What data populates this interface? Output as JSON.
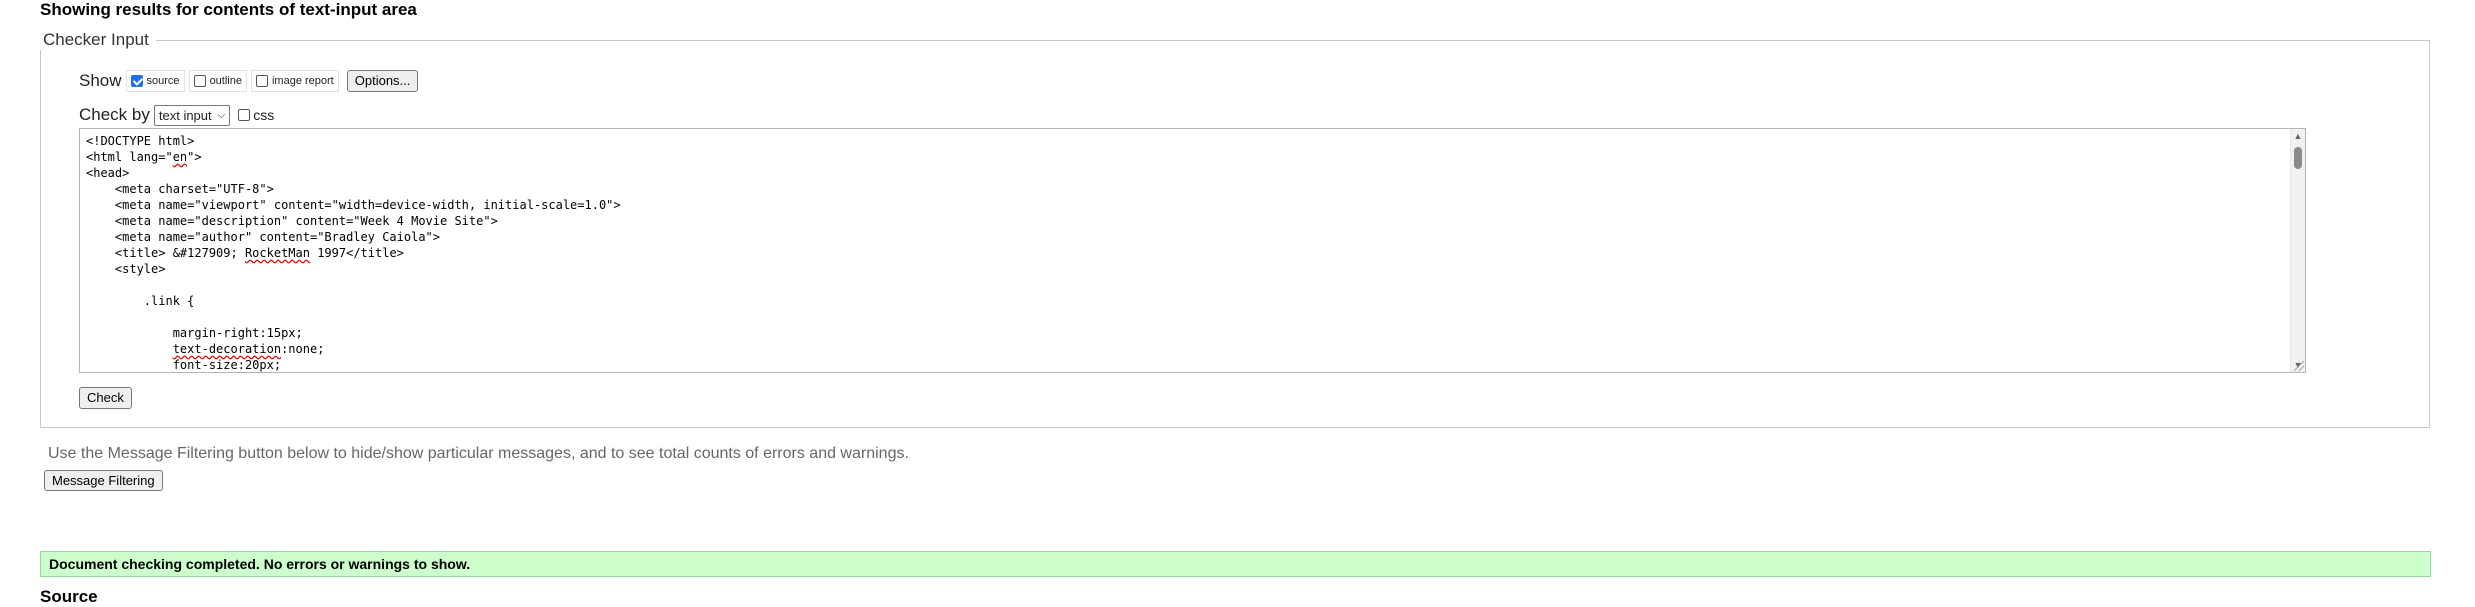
{
  "page": {
    "heading": "Showing results for contents of text-input area"
  },
  "checker": {
    "legend": "Checker Input",
    "show_label": "Show",
    "show_options": [
      {
        "label": "source",
        "checked": true
      },
      {
        "label": "outline",
        "checked": false
      },
      {
        "label": "image report",
        "checked": false
      }
    ],
    "options_button": "Options...",
    "check_by_label": "Check by",
    "check_by_select": "text input",
    "css_label": "css",
    "css_checked": false,
    "check_button": "Check"
  },
  "source_lines": [
    "<!DOCTYPE html>",
    "<html lang=\"en\">",
    "<head>",
    "    <meta charset=\"UTF-8\">",
    "    <meta name=\"viewport\" content=\"width=device-width, initial-scale=1.0\">",
    "    <meta name=\"description\" content=\"Week 4 Movie Site\">",
    "    <meta name=\"author\" content=\"Bradley Caiola\">",
    "    <title> &#127909; RocketMan 1997</title>",
    "    <style>",
    "",
    "        .link {",
    "",
    "            margin-right:15px;",
    "            text-decoration:none;",
    "            font-size:20px;"
  ],
  "message_filtering": {
    "info": "Use the Message Filtering button below to hide/show particular messages, and to see total counts of errors and warnings.",
    "button": "Message Filtering"
  },
  "result": {
    "message": "Document checking completed. No errors or warnings to show."
  },
  "source_section": {
    "heading": "Source"
  },
  "colors": {
    "success_bg": "#ccffcc",
    "checkbox_accent": "#1a73e8"
  }
}
